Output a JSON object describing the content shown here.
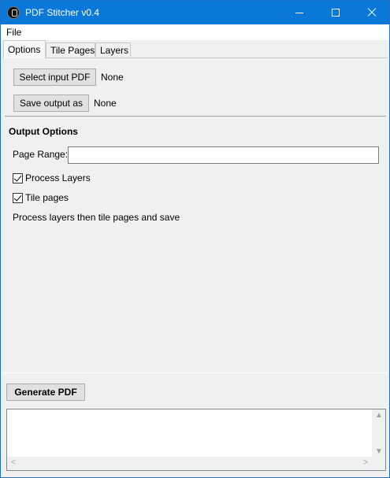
{
  "window": {
    "title": "PDF Stitcher v0.4",
    "accent": "#0a78d7"
  },
  "menu": {
    "file": "File"
  },
  "tabs": [
    {
      "label": "Options",
      "active": true
    },
    {
      "label": "Tile Pages",
      "active": false
    },
    {
      "label": "Layers",
      "active": false
    }
  ],
  "options": {
    "select_input_label": "Select input PDF",
    "input_value": "None",
    "save_output_label": "Save output as",
    "output_value": "None",
    "section_title": "Output Options",
    "page_range_label": "Page Range:",
    "page_range_value": "",
    "process_layers_label": "Process Layers",
    "process_layers_checked": true,
    "tile_pages_label": "Tile pages",
    "tile_pages_checked": true,
    "status": "Process layers then tile pages and save"
  },
  "footer": {
    "generate_label": "Generate PDF",
    "log_text": ""
  },
  "icons": {
    "scroll_up": "▲",
    "scroll_down": "▼",
    "scroll_left": "<",
    "scroll_right": ">"
  }
}
